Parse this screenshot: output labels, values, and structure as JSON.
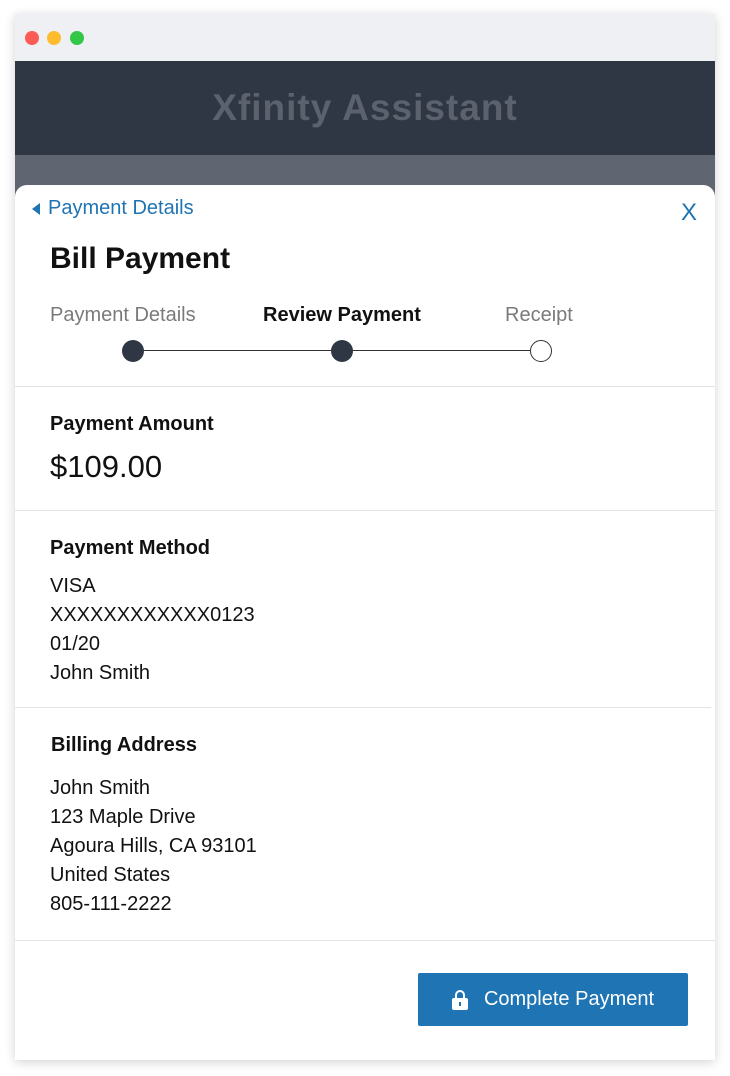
{
  "app": {
    "title": "Xfinity Assistant"
  },
  "nav": {
    "back_label": "Payment Details",
    "close_label": "X"
  },
  "page": {
    "title": "Bill Payment"
  },
  "steps": [
    {
      "label": "Payment Details",
      "state": "completed"
    },
    {
      "label": "Review Payment",
      "state": "current"
    },
    {
      "label": "Receipt",
      "state": "pending"
    }
  ],
  "payment_amount": {
    "heading": "Payment Amount",
    "value": "$109.00"
  },
  "payment_method": {
    "heading": "Payment Method",
    "lines": [
      "VISA",
      "XXXXXXXXXXXX0123",
      "01/20",
      "John Smith"
    ]
  },
  "billing_address": {
    "heading": "Billing Address",
    "lines": [
      "John Smith",
      "123 Maple Drive",
      "Agoura Hills, CA 93101",
      "United States",
      "805-111-2222"
    ]
  },
  "actions": {
    "complete_label": "Complete Payment"
  },
  "colors": {
    "accent": "#1f74b3",
    "header_bg": "#303744",
    "step_complete": "#303744"
  }
}
